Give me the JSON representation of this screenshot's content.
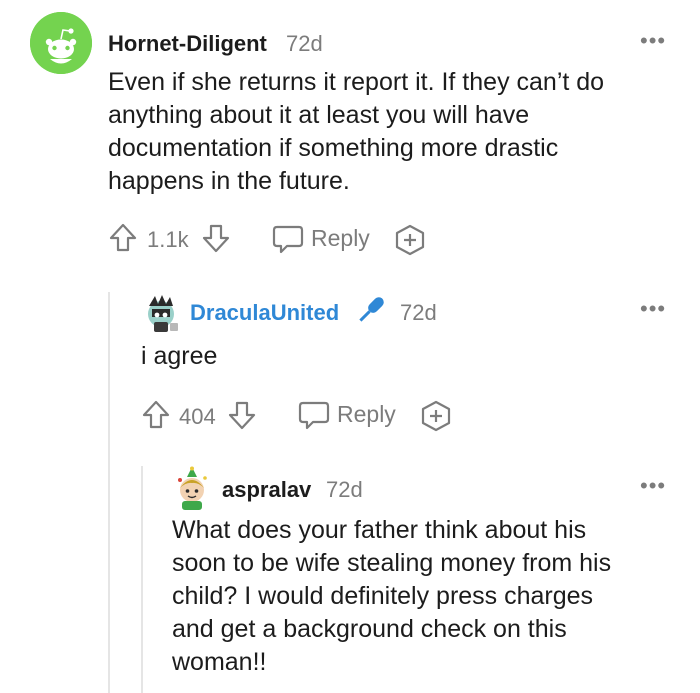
{
  "comments": [
    {
      "username": "Hornet-Diligent",
      "age": "72d",
      "lines": [
        "Even if she returns it report it. If they can’t do",
        "anything about it at least you will have",
        "documentation if something more drastic",
        "happens in the future."
      ],
      "score": "1.1k",
      "reply_label": "Reply"
    },
    {
      "username": "DraculaUnited",
      "age": "72d",
      "lines": [
        "i agree"
      ],
      "score": "404",
      "reply_label": "Reply"
    },
    {
      "username": "aspralav",
      "age": "72d",
      "lines": [
        "What does your father think about his",
        "soon to be wife stealing money from his",
        "child? I would definitely press charges",
        "and get a background check on this",
        "woman!!"
      ]
    }
  ],
  "more_label": "•••",
  "colors": {
    "avatar_green": "#74d34f",
    "username_blue": "#2f88d6",
    "muted": "#7c7c7c"
  },
  "icons": [
    "upvote-icon",
    "downvote-icon",
    "reply-bubble-icon",
    "award-plus-icon",
    "microphone-icon"
  ]
}
